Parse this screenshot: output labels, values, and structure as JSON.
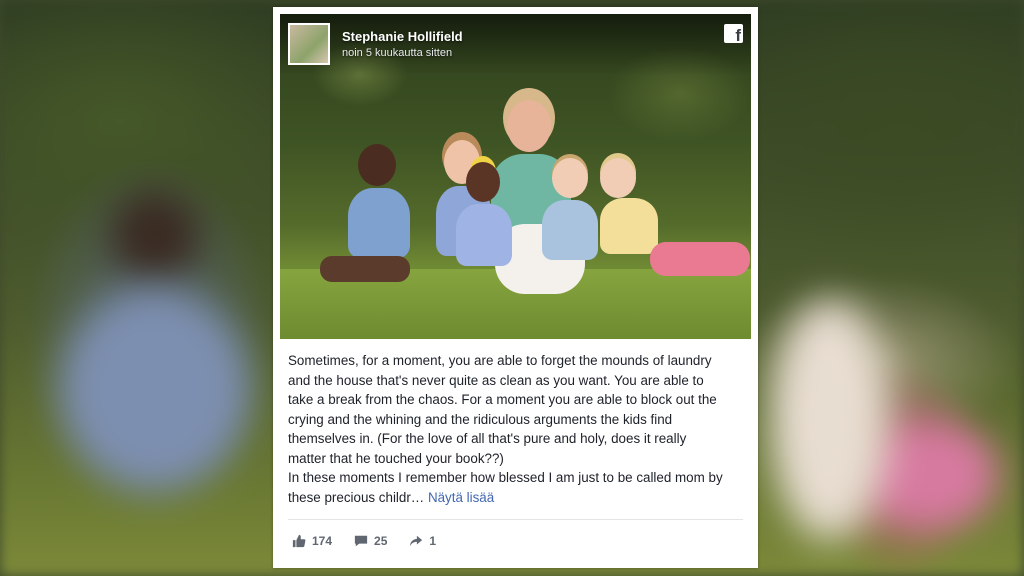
{
  "post": {
    "author": "Stephanie Hollifield",
    "time": "noin 5 kuukautta sitten",
    "icon": "facebook-icon",
    "paragraph1": "Sometimes, for a moment, you are able to forget the mounds of laundry and the house that's never quite as clean as you want. You are able to take a break from the chaos. For a moment you are able to block out the crying and the whining and the ridiculous arguments the kids find themselves in. (For the love of all that's pure and holy, does it really matter that he touched your book??)",
    "paragraph2": "In these moments I remember how blessed I am just to be called mom by these precious childr…",
    "see_more": "Näytä lisää"
  },
  "stats": {
    "likes": "174",
    "comments": "25",
    "shares": "1"
  },
  "colors": {
    "link": "#4267b2",
    "text": "#1d2129",
    "meta": "#606770"
  }
}
